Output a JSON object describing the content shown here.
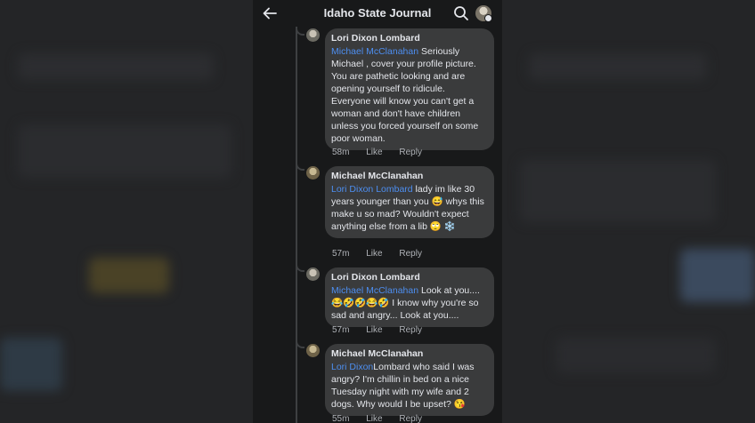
{
  "header": {
    "title": "Idaho State Journal"
  },
  "comments": [
    {
      "author": "Lori Dixon Lombard",
      "mention": "Michael McClanahan",
      "body": " Seriously Michael , cover your profile picture. You are pathetic looking and are opening yourself to ridicule. Everyone will know you can't get a woman and don't have children unless you forced yourself on some poor woman.",
      "time": "58m",
      "like": "Like",
      "reply": "Reply"
    },
    {
      "author": "Michael McClanahan",
      "mention": "Lori Dixon Lombard",
      "body": " lady im like 30 years younger than you 😅 whys this make u so mad? Wouldn't expect anything else from a lib 🙄 ❄️",
      "time": "57m",
      "like": "Like",
      "reply": "Reply"
    },
    {
      "author": "Lori Dixon Lombard",
      "mention": "Michael McClanahan",
      "body": " Look at you.... 😂🤣🤣😂🤣  I know why you're so sad and angry... Look at you....",
      "time": "57m",
      "like": "Like",
      "reply": "Reply"
    },
    {
      "author": "Michael McClanahan",
      "mention": "Lori Dixon",
      "body": "Lombard who said I was angry? I'm chillin in bed on a nice Tuesday night with my wife and 2 dogs. Why would I be upset? 😘",
      "time": "55m",
      "like": "Like",
      "reply": "Reply"
    }
  ]
}
